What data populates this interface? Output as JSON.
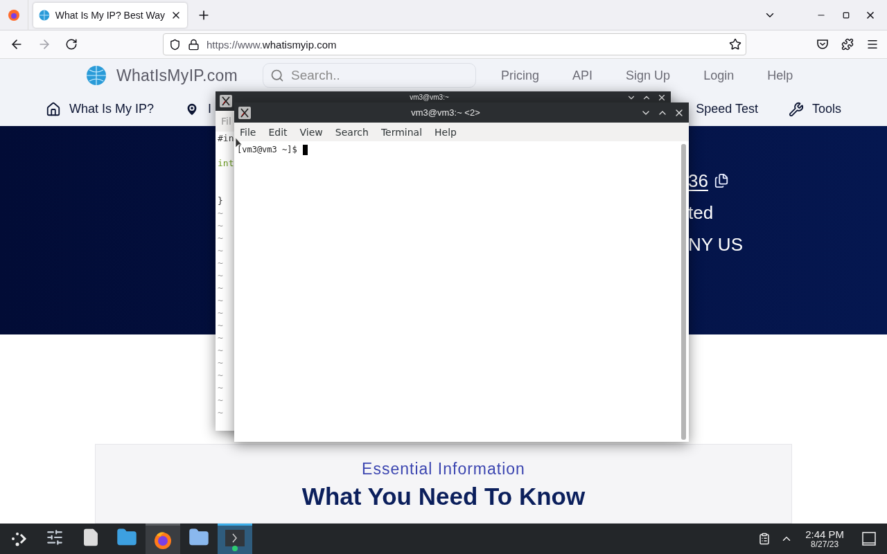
{
  "browser": {
    "tabs": [
      {
        "title": "What Is My IP? Best Way",
        "selected": true
      }
    ],
    "url": {
      "prefix": "https://www.",
      "domain": "whatismyip.com"
    },
    "forward_disabled": true
  },
  "site": {
    "logo": "WhatIsMyIP.com",
    "search_placeholder": "Search..",
    "top_links": [
      "Pricing",
      "API",
      "Sign Up",
      "Login",
      "Help"
    ],
    "nav_left": [
      {
        "label": "What Is My IP?"
      },
      {
        "label": "I"
      }
    ],
    "nav_right": [
      {
        "label": "Speed Test"
      },
      {
        "label": "Tools"
      }
    ],
    "hero_lines": [
      {
        "text": "36",
        "kind": "ip"
      },
      {
        "text": "ted",
        "kind": "plain"
      },
      {
        "text": "NY US",
        "kind": "plain"
      }
    ],
    "section": {
      "eyebrow": "Essential Information",
      "heading": "What You Need To Know"
    }
  },
  "back_window": {
    "title": "vm3@vm3:~",
    "menu": [
      "Fil"
    ],
    "lines": [
      {
        "kind": "code",
        "text": "#in"
      },
      {
        "kind": "blank"
      },
      {
        "kind": "type",
        "text": "int"
      },
      {
        "kind": "blank"
      },
      {
        "kind": "blank"
      },
      {
        "kind": "code",
        "text": "}"
      },
      {
        "kind": "filler",
        "text": "~"
      },
      {
        "kind": "filler",
        "text": "~"
      },
      {
        "kind": "filler",
        "text": "~"
      },
      {
        "kind": "filler",
        "text": "~"
      },
      {
        "kind": "filler",
        "text": "~"
      },
      {
        "kind": "filler",
        "text": "~"
      },
      {
        "kind": "filler",
        "text": "~"
      },
      {
        "kind": "filler",
        "text": "~"
      },
      {
        "kind": "filler",
        "text": "~"
      },
      {
        "kind": "filler",
        "text": "~"
      },
      {
        "kind": "filler",
        "text": "~"
      },
      {
        "kind": "filler",
        "text": "~"
      },
      {
        "kind": "filler",
        "text": "~"
      },
      {
        "kind": "filler",
        "text": "~"
      },
      {
        "kind": "filler",
        "text": "~"
      },
      {
        "kind": "filler",
        "text": "~"
      },
      {
        "kind": "filler",
        "text": "~"
      }
    ]
  },
  "front_window": {
    "title": "vm3@vm3:~ <2>",
    "menu": [
      "File",
      "Edit",
      "View",
      "Search",
      "Terminal",
      "Help"
    ],
    "prompt": "[vm3@vm3 ~]$"
  },
  "taskbar": {
    "apps": [
      {
        "kind": "launcher",
        "selected": false
      },
      {
        "kind": "settings",
        "selected": false
      },
      {
        "kind": "document",
        "selected": false
      },
      {
        "kind": "folder",
        "selected": false
      },
      {
        "kind": "firefox",
        "selected": false
      },
      {
        "kind": "home-folder",
        "selected": false
      },
      {
        "kind": "terminal",
        "selected": true
      }
    ],
    "time": "2:44 PM",
    "date": "8/27/23"
  }
}
